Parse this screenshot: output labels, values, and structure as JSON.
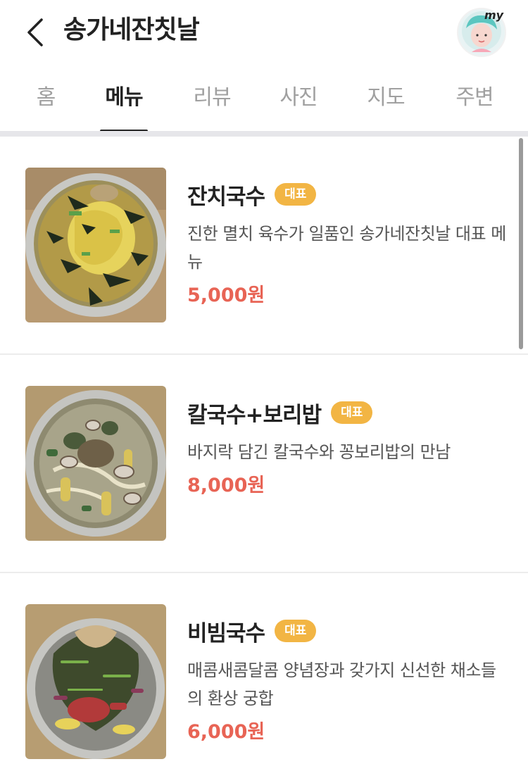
{
  "header": {
    "title": "송가네잔칫날",
    "back_icon": "chevron-left-icon",
    "profile_badge": "my"
  },
  "tabs": [
    {
      "label": "홈",
      "active": false
    },
    {
      "label": "메뉴",
      "active": true
    },
    {
      "label": "리뷰",
      "active": false
    },
    {
      "label": "사진",
      "active": false
    },
    {
      "label": "지도",
      "active": false
    },
    {
      "label": "주변",
      "active": false
    }
  ],
  "menu": [
    {
      "name": "잔치국수",
      "badge": "대표",
      "description": "진한 멸치 육수가 일품인 송가네잔칫날 대표 메뉴",
      "price": "5,000원"
    },
    {
      "name": "칼국수+보리밥",
      "badge": "대표",
      "description": "바지락 담긴 칼국수와 꽁보리밥의 만남",
      "price": "8,000원"
    },
    {
      "name": "비빔국수",
      "badge": "대표",
      "description": "매콤새콤달콤 양념장과 갖가지 신선한 채소들의 환상 궁합",
      "price": "6,000원"
    }
  ],
  "colors": {
    "accent_price": "#e86455",
    "badge": "#f2b544",
    "active_tab": "#222222",
    "inactive_tab": "#a0a0a0"
  }
}
